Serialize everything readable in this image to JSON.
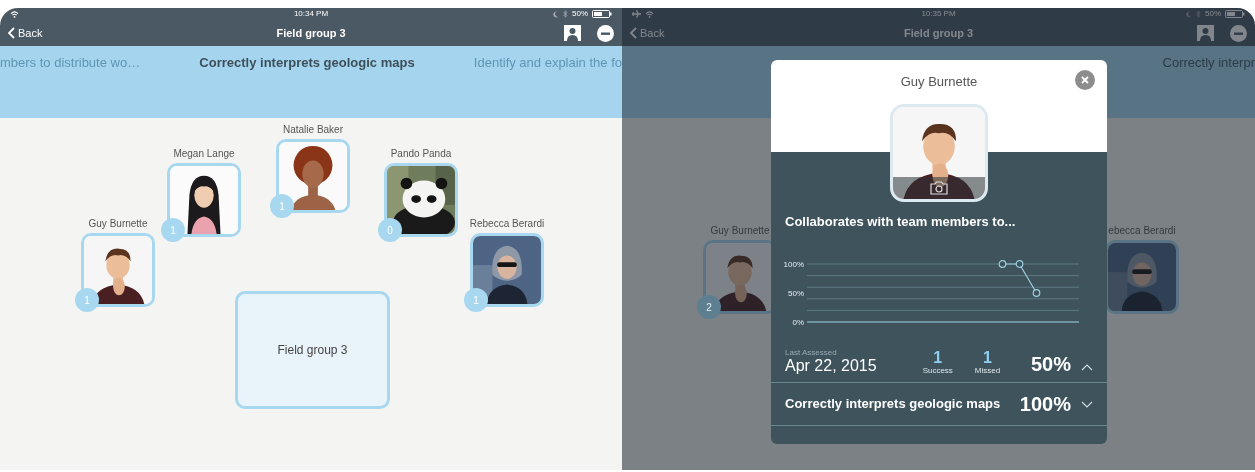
{
  "screens": [
    {
      "status_bar": {
        "time": "10:34 PM",
        "battery": "50%",
        "airplane_mode": false
      },
      "nav": {
        "back": "Back",
        "title": "Field group 3"
      },
      "header": [
        {
          "label": "mbers to distribute wo…",
          "selected": false
        },
        {
          "label": "Correctly interprets geologic maps",
          "selected": true
        },
        {
          "label": "Identify and explain the fo",
          "selected": false
        }
      ],
      "students": [
        {
          "name": "Guy Burnette",
          "count": "1"
        },
        {
          "name": "Megan Lange",
          "count": "1"
        },
        {
          "name": "Natalie Baker",
          "count": "1"
        },
        {
          "name": "Pando Panda",
          "count": "0"
        },
        {
          "name": "Rebecca Berardi",
          "count": "1"
        }
      ],
      "group": {
        "label": "Field group 3"
      }
    },
    {
      "status_bar": {
        "time": "10:35 PM",
        "battery": "50%",
        "airplane_mode": true
      },
      "nav": {
        "back": "Back",
        "title": "Field group 3"
      },
      "header": [
        {
          "label": "Correctly interpr",
          "selected": false
        }
      ],
      "students": [
        {
          "name": "Guy Burnette",
          "count": "2"
        },
        {
          "name": "ebecca Berardi"
        }
      ],
      "modal": {
        "name": "Guy Burnette",
        "skills": [
          {
            "title": "Collaborates with team members to...",
            "expanded": true,
            "chart_data": {
              "type": "line",
              "categories": [
                null,
                null,
                null,
                null,
                null,
                null,
                null,
                null,
                null,
                null,
                null,
                null,
                null,
                null,
                null,
                null
              ],
              "ylim": [
                0,
                100
              ],
              "yticks": [
                {
                  "value": 0,
                  "label": "0%"
                },
                {
                  "value": 50,
                  "label": "50%"
                },
                {
                  "value": 100,
                  "label": "100%"
                }
              ],
              "series": [
                {
                  "color": "#9ccfe0",
                  "marker": "circle",
                  "values": [
                    null,
                    null,
                    null,
                    null,
                    null,
                    null,
                    null,
                    null,
                    null,
                    null,
                    null,
                    100,
                    100,
                    50,
                    null,
                    null
                  ]
                }
              ]
            },
            "last_assessed_label": "Last Assessed",
            "date": "Apr 22, 2015",
            "success": "1",
            "success_label": "Success",
            "missed": "1",
            "missed_label": "Missed",
            "percent": "50%"
          },
          {
            "title": "Correctly interprets geologic maps",
            "expanded": false,
            "percent": "100%"
          }
        ]
      }
    }
  ]
}
